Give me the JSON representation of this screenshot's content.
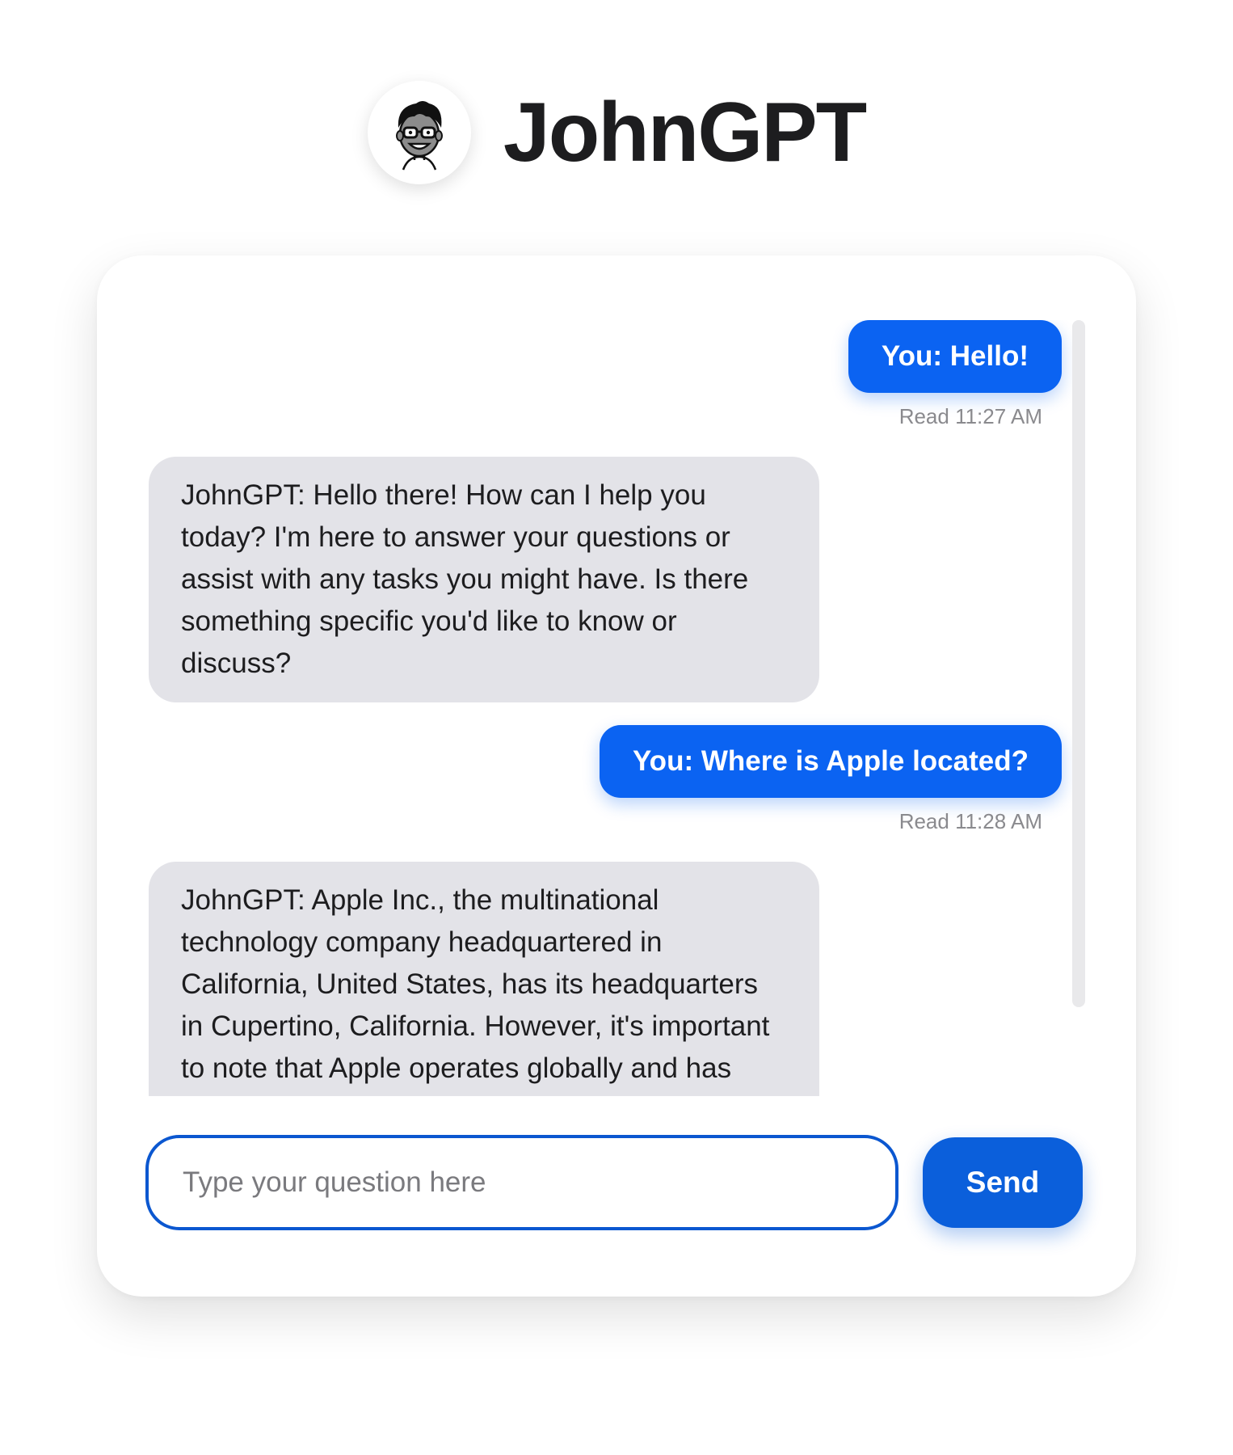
{
  "app": {
    "title": "JohnGPT",
    "logo_icon": "john-avatar-icon"
  },
  "messages": [
    {
      "role": "user",
      "text": "You: Hello!",
      "read": "Read 11:27 AM"
    },
    {
      "role": "bot",
      "text": "JohnGPT:  Hello there! How can I help you today? I'm here to answer your questions or assist with any tasks you might have. Is there something specific you'd like to know or discuss?"
    },
    {
      "role": "user",
      "text": "You: Where is Apple located?",
      "read": "Read 11:28 AM"
    },
    {
      "role": "bot",
      "text": "JohnGPT:  Apple Inc., the multinational technology company headquartered in California, United States, has its headquarters in Cupertino, California. However, it's important to note that Apple operates globally and has numerous offices, retail stores, and data centers around the world."
    }
  ],
  "input": {
    "placeholder": "Type your question here",
    "value": ""
  },
  "send_label": "Send",
  "colors": {
    "user_bubble": "#0b63f2",
    "bot_bubble": "#e3e3e8",
    "send_button": "#0b5fdb",
    "input_border": "#0b57d0"
  }
}
